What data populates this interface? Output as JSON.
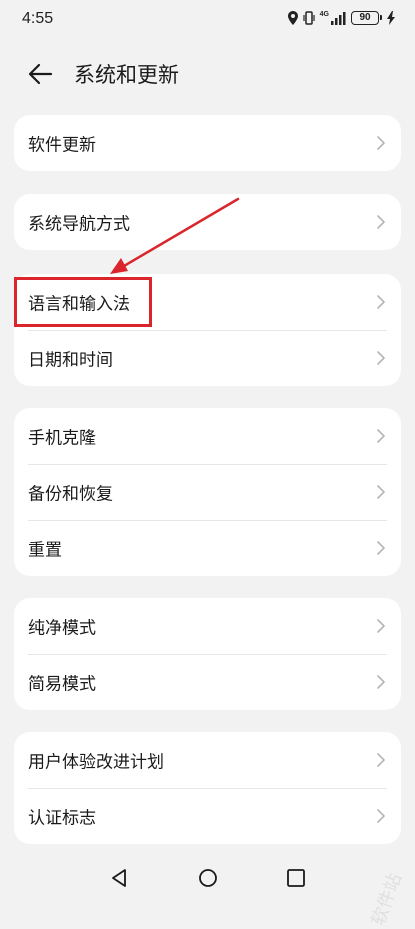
{
  "status_bar": {
    "time": "4:55",
    "network_label": "4G",
    "battery_level": "90"
  },
  "header": {
    "title": "系统和更新"
  },
  "groups": [
    {
      "items": [
        {
          "label": "软件更新"
        }
      ]
    },
    {
      "items": [
        {
          "label": "系统导航方式"
        }
      ]
    },
    {
      "items": [
        {
          "label": "语言和输入法"
        },
        {
          "label": "日期和时间"
        }
      ]
    },
    {
      "items": [
        {
          "label": "手机克隆"
        },
        {
          "label": "备份和恢复"
        },
        {
          "label": "重置"
        }
      ]
    },
    {
      "items": [
        {
          "label": "纯净模式"
        },
        {
          "label": "简易模式"
        }
      ]
    },
    {
      "items": [
        {
          "label": "用户体验改进计划"
        },
        {
          "label": "认证标志"
        }
      ]
    }
  ],
  "annotation": {
    "color": "#d9252b"
  },
  "watermark": "软件站",
  "colors": {
    "background": "#f2f2f2",
    "card": "#ffffff",
    "chevron": "#b5b5b5"
  }
}
